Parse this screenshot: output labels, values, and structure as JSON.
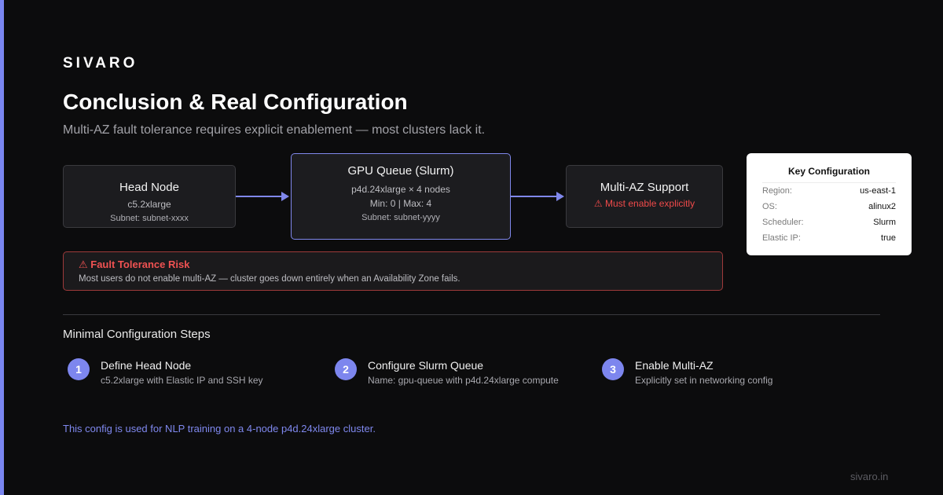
{
  "brand": "SIVARO",
  "title": "Conclusion & Real Configuration",
  "subtitle": "Multi-AZ fault tolerance requires explicit enablement — most clusters lack it.",
  "diagram": {
    "head_node": {
      "name": "Head Node",
      "instance": "c5.2xlarge",
      "subnet": "Subnet: subnet-xxxx"
    },
    "gpu_queue": {
      "name": "GPU Queue (Slurm)",
      "instance": "p4d.24xlarge × 4 nodes",
      "scaling": "Min: 0 | Max: 4",
      "subnet": "Subnet: subnet-yyyy"
    },
    "multi_az": {
      "name": "Multi-AZ Support",
      "warning": "⚠ Must enable explicitly"
    }
  },
  "key_config": {
    "title": "Key Configuration",
    "rows": [
      {
        "label": "Region:",
        "value": "us-east-1"
      },
      {
        "label": "OS:",
        "value": "alinux2"
      },
      {
        "label": "Scheduler:",
        "value": "Slurm"
      },
      {
        "label": "Elastic IP:",
        "value": "true"
      }
    ]
  },
  "risk": {
    "title": "⚠ Fault Tolerance Risk",
    "text": "Most users do not enable multi-AZ — cluster goes down entirely when an Availability Zone fails."
  },
  "steps": {
    "heading": "Minimal Configuration Steps",
    "items": [
      {
        "number": "1",
        "title": "Define Head Node",
        "desc": "c5.2xlarge with Elastic IP and SSH key"
      },
      {
        "number": "2",
        "title": "Configure Slurm Queue",
        "desc": "Name: gpu-queue with p4d.24xlarge compute"
      },
      {
        "number": "3",
        "title": "Enable Multi-AZ",
        "desc": "Explicitly set in networking config"
      }
    ]
  },
  "footnote": "This config is used for NLP training on a 4-node p4d.24xlarge cluster.",
  "site": "sivaro.in",
  "colors": {
    "accent": "#7a86f0",
    "background": "#0c0c0d",
    "warning": "#f04a4a"
  }
}
